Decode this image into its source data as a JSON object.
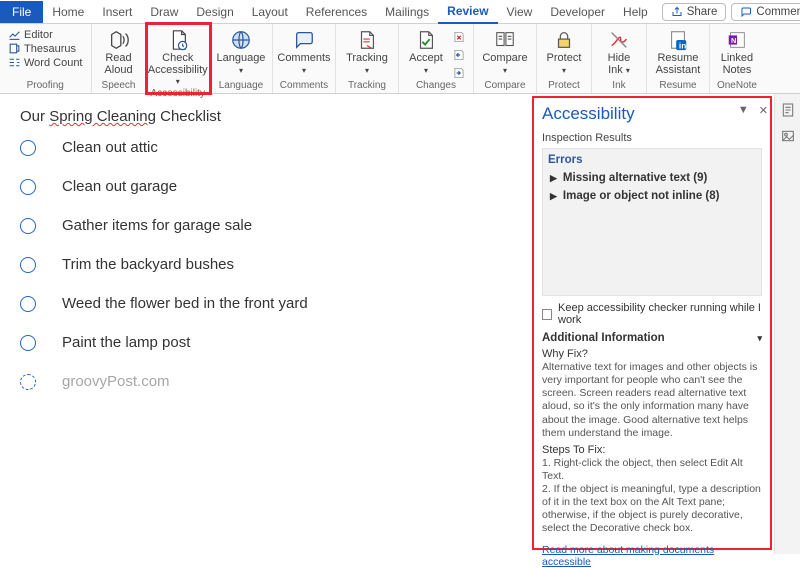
{
  "tabs": {
    "file": "File",
    "home": "Home",
    "insert": "Insert",
    "draw": "Draw",
    "design": "Design",
    "layout": "Layout",
    "references": "References",
    "mailings": "Mailings",
    "review": "Review",
    "view": "View",
    "developer": "Developer",
    "help": "Help"
  },
  "titlebar": {
    "share": "Share",
    "comments": "Comments"
  },
  "ribbon": {
    "proofing": {
      "editor": "Editor",
      "thesaurus": "Thesaurus",
      "wordcount": "Word Count",
      "label": "Proofing"
    },
    "speech": {
      "read": "Read",
      "aloud": "Aloud",
      "label": "Speech"
    },
    "accessibility": {
      "check": "Check",
      "accessibility": "Accessibility",
      "label": "Accessibility"
    },
    "language": {
      "language": "Language",
      "label": "Language"
    },
    "comments": {
      "comments": "Comments",
      "label": "Comments"
    },
    "tracking": {
      "tracking": "Tracking",
      "label": "Tracking"
    },
    "changes": {
      "accept": "Accept",
      "label": "Changes"
    },
    "compare": {
      "compare": "Compare",
      "label": "Compare"
    },
    "protect": {
      "protect": "Protect",
      "label": "Protect"
    },
    "ink": {
      "hide": "Hide",
      "ink": "Ink",
      "label": "Ink"
    },
    "resume": {
      "resume": "Resume",
      "assistant": "Assistant",
      "label": "Resume"
    },
    "onenote": {
      "linked": "Linked",
      "notes": "Notes",
      "label": "OneNote"
    }
  },
  "doc": {
    "title_pre": "Our ",
    "title_u": "Spring Cleaning",
    "title_post": " Checklist",
    "items": [
      "Clean out attic",
      "Clean out garage",
      "Gather items for garage sale",
      "Trim the backyard bushes",
      "Weed the flower bed in the front yard",
      "Paint the lamp post"
    ],
    "watermark": "groovyPost.com"
  },
  "pane": {
    "title": "Accessibility",
    "results": "Inspection Results",
    "errors_hdr": "Errors",
    "err1": "Missing alternative text (9)",
    "err2": "Image or object not inline (8)",
    "keep": "Keep accessibility checker running while I work",
    "addl": "Additional Information",
    "why_q": "Why Fix?",
    "why_a": "Alternative text for images and other objects is very important for people who can't see the screen. Screen readers read alternative text aloud, so it's the only information many have about the image. Good alternative text helps them understand the image.",
    "steps_q": "Steps To Fix:",
    "steps_a": "1. Right-click the object, then select Edit Alt Text.\n2. If the object is meaningful, type a description of it in the text box on the Alt Text pane; otherwise, if the object is purely decorative, select the Decorative check box.",
    "link": "Read more about making documents accessible"
  }
}
